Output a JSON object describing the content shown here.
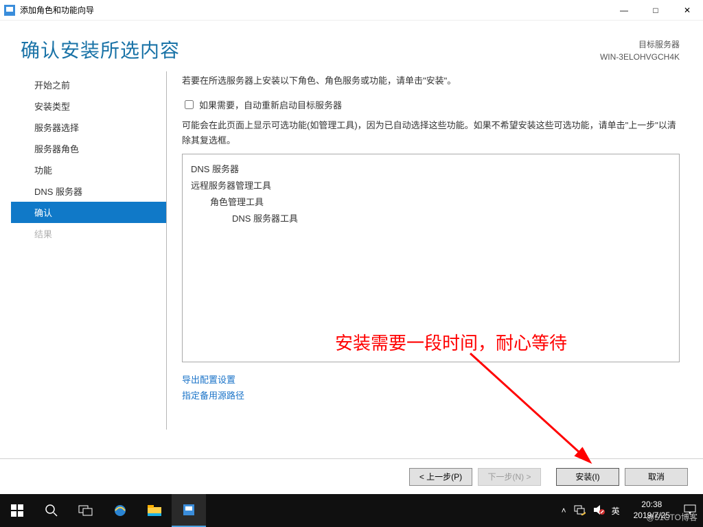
{
  "window": {
    "title": "添加角色和功能向导",
    "minimize": "—",
    "maximize": "□",
    "close": "✕"
  },
  "header": {
    "heading": "确认安装所选内容",
    "target_label": "目标服务器",
    "target_value": "WIN-3ELOHVGCH4K"
  },
  "sidebar": {
    "items": [
      {
        "label": "开始之前",
        "state": "normal"
      },
      {
        "label": "安装类型",
        "state": "normal"
      },
      {
        "label": "服务器选择",
        "state": "normal"
      },
      {
        "label": "服务器角色",
        "state": "normal"
      },
      {
        "label": "功能",
        "state": "normal"
      },
      {
        "label": "DNS 服务器",
        "state": "normal"
      },
      {
        "label": "确认",
        "state": "active"
      },
      {
        "label": "结果",
        "state": "disabled"
      }
    ]
  },
  "content": {
    "desc": "若要在所选服务器上安装以下角色、角色服务或功能，请单击\"安装\"。",
    "checkbox_label": "如果需要，自动重新启动目标服务器",
    "note": "可能会在此页面上显示可选功能(如管理工具)，因为已自动选择这些功能。如果不希望安装这些可选功能，请单击\"上一步\"以清除其复选框。",
    "list": {
      "l1a": "DNS 服务器",
      "l1b": "远程服务器管理工具",
      "l2": "角色管理工具",
      "l3": "DNS 服务器工具"
    },
    "links": {
      "export": "导出配置设置",
      "altsrc": "指定备用源路径"
    }
  },
  "footer": {
    "prev": "< 上一步(P)",
    "next": "下一步(N) >",
    "install": "安装(I)",
    "cancel": "取消"
  },
  "annotation": {
    "text": "安装需要一段时间，耐心等待"
  },
  "taskbar": {
    "ime": "英",
    "time": "20:38",
    "date": "2019/7/25"
  },
  "watermark": "@51CTO博客"
}
